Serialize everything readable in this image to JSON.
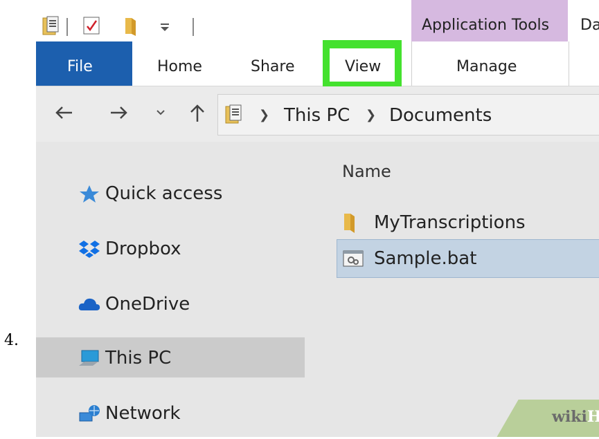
{
  "step_number": "4.",
  "window": {
    "title_partial": "Da"
  },
  "ribbon": {
    "contextual_tab_group": "Application Tools",
    "tabs": [
      {
        "label": "File"
      },
      {
        "label": "Home"
      },
      {
        "label": "Share"
      },
      {
        "label": "View",
        "highlighted": true
      },
      {
        "label": "Manage"
      }
    ]
  },
  "address_bar": {
    "breadcrumbs": [
      "This PC",
      "Documents"
    ]
  },
  "nav_pane": {
    "items": [
      {
        "label": "Quick access",
        "icon": "star-pin-icon"
      },
      {
        "label": "Dropbox",
        "icon": "dropbox-icon"
      },
      {
        "label": "OneDrive",
        "icon": "cloud-icon"
      },
      {
        "label": "This PC",
        "icon": "computer-icon",
        "selected": true
      },
      {
        "label": "Network",
        "icon": "network-icon"
      }
    ]
  },
  "file_list": {
    "column_header": "Name",
    "rows": [
      {
        "name": "MyTranscriptions",
        "icon": "folder-icon"
      },
      {
        "name": "Sample.bat",
        "icon": "batch-file-icon",
        "selected": true
      }
    ]
  },
  "watermark": {
    "part1": "wiki",
    "part2": "How"
  },
  "colors": {
    "highlight_green": "#44e12e",
    "file_tab_blue": "#1c5fae",
    "contextual_purple": "#d6b9e0",
    "selection_blue": "#c3d3e3"
  }
}
